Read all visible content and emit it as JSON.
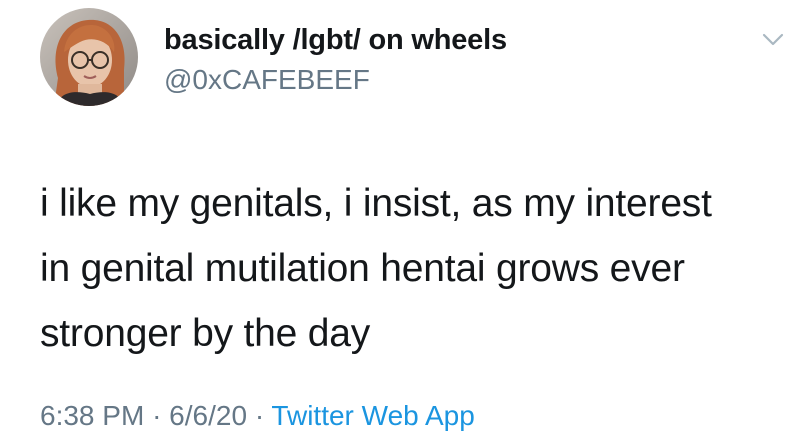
{
  "user": {
    "display_name": "basically /lgbt/ on wheels",
    "handle": "@0xCAFEBEEF"
  },
  "tweet": {
    "lines": [
      "i like my genitals, i insist, as my interest",
      "in genital mutilation hentai grows ever",
      "stronger by the day"
    ],
    "time": "6:38 PM",
    "separator": "·",
    "date": "6/6/20",
    "source": "Twitter Web App"
  },
  "icons": {
    "menu": "chevron-down-icon",
    "avatar": "profile-photo"
  },
  "colors": {
    "text": "#14171a",
    "secondary": "#657786",
    "link": "#1b95e0",
    "background": "#ffffff"
  }
}
